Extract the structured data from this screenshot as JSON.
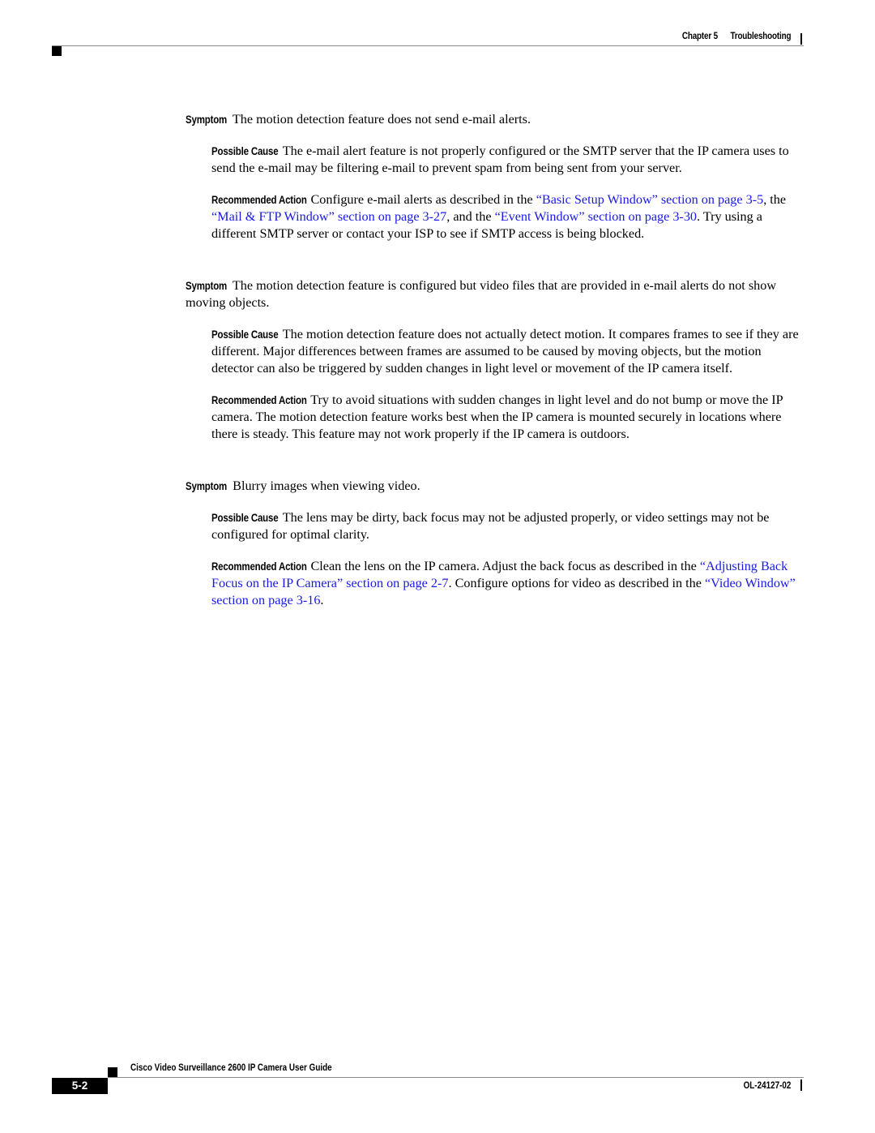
{
  "header": {
    "chapter": "Chapter 5",
    "title": "Troubleshooting"
  },
  "link_color": "#1a1ae6",
  "entries": [
    {
      "symptom_label": "Symptom",
      "symptom": "The motion detection feature does not send e-mail alerts.",
      "cause_label": "Possible Cause",
      "cause": "The e-mail alert feature is not properly configured or the SMTP server that the IP camera uses to send the e-mail may be filtering e-mail to prevent spam from being sent from your server.",
      "action_label": "Recommended Action",
      "action": {
        "t1": "Configure e-mail alerts as described in the ",
        "l1": "“Basic Setup Window” section on page 3-5",
        "t2": ", the ",
        "l2": "“Mail & FTP Window” section on page 3-27",
        "t3": ", and the ",
        "l3": "“Event Window” section on page 3-30",
        "t4": ". Try using a different SMTP server or contact your ISP to see if SMTP access is being blocked."
      }
    },
    {
      "symptom_label": "Symptom",
      "symptom": "The motion detection feature is configured but video files that are provided in e-mail alerts do not show moving objects.",
      "cause_label": "Possible Cause",
      "cause": "The motion detection feature does not actually detect motion. It compares frames to see if they are different. Major differences between frames are assumed to be caused by moving objects, but the motion detector can also be triggered by sudden changes in light level or movement of the IP camera itself.",
      "action_label": "Recommended Action",
      "action": {
        "t1": "Try to avoid situations with sudden changes in light level and do not bump or move the IP camera. The motion detection feature works best when the IP camera is mounted securely in locations where there is steady. This feature may not work properly if the IP camera is outdoors."
      }
    },
    {
      "symptom_label": "Symptom",
      "symptom": "Blurry images when viewing video.",
      "cause_label": "Possible Cause",
      "cause": "The lens may be dirty, back focus may not be adjusted properly, or video settings may not be configured for optimal clarity.",
      "action_label": "Recommended Action",
      "action": {
        "t1": "Clean the lens on the IP camera. Adjust the back focus as described in the ",
        "l1": "“Adjusting Back Focus on the IP Camera” section on page 2-7",
        "t2": ". Configure options for video as described in the ",
        "l2": "“Video Window” section on page 3-16",
        "t3": "."
      }
    }
  ],
  "footer": {
    "guide_title": "Cisco Video Surveillance 2600 IP Camera User Guide",
    "page_number": "5-2",
    "doc_id": "OL-24127-02"
  }
}
